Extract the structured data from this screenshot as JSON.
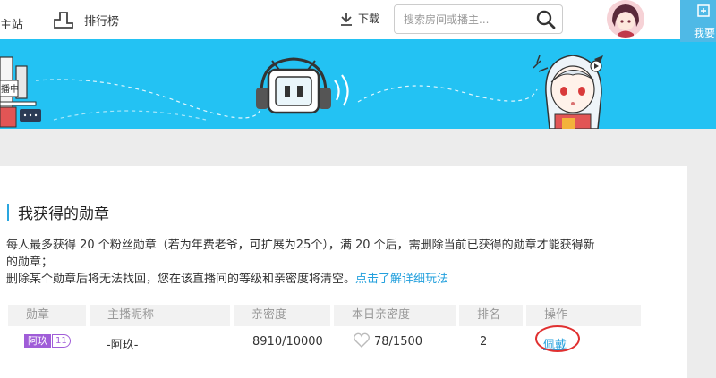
{
  "nav": {
    "main_site": "主站",
    "ranking": "排行榜",
    "download": "下载",
    "want_label": "我要"
  },
  "search": {
    "placeholder": "搜索房间或播主..."
  },
  "banner": {
    "sign_text": "播中"
  },
  "section": {
    "title": "我获得的勋章",
    "desc_line1": "每人最多获得 20 个粉丝勋章（若为年费老爷，可扩展为25个），满 20 个后，需删除当前已获得的勋章才能获得新",
    "desc_line2": "的勋章；",
    "desc_line3": "删除某个勋章后将无法找回，您在该直播间的等级和亲密度将清空。",
    "learn_more_link": "点击了解详细玩法"
  },
  "table": {
    "headers": [
      "勋章",
      "主播昵称",
      "亲密度",
      "本日亲密度",
      "排名",
      "操作"
    ],
    "rows": [
      {
        "badge_name": "阿玖",
        "badge_level": "11",
        "streamer": "-阿玖-",
        "intimacy": "8910/10000",
        "today_intimacy": "78/1500",
        "rank": "2",
        "action": "佩戴"
      }
    ]
  },
  "colors": {
    "banner": "#23c2f3",
    "accent_link": "#23a0dd",
    "badge": "#a05dd8",
    "annotation_circle": "#e03030"
  }
}
